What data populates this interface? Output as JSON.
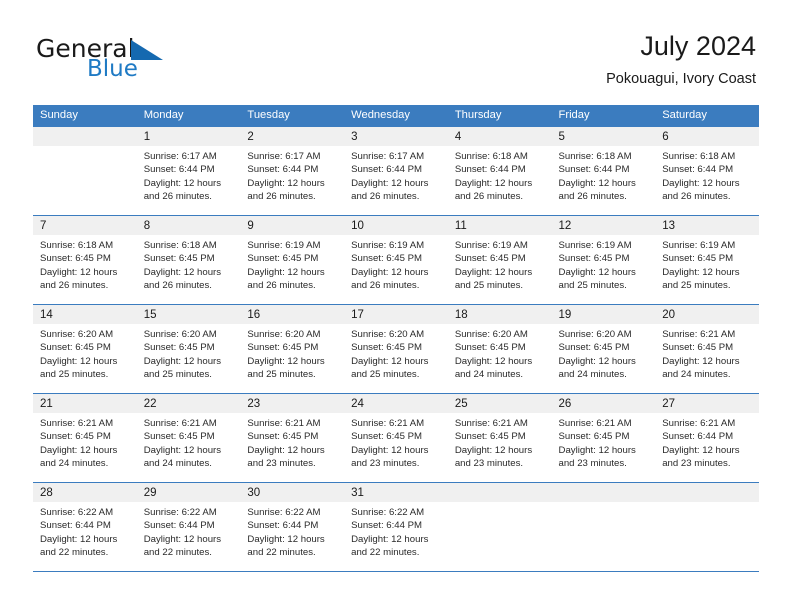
{
  "brand": {
    "name_part1": "General",
    "name_part2": "Blue",
    "logo_icon": "triangle-flag-icon",
    "accent_color": "#1569b0"
  },
  "header": {
    "title": "July 2024",
    "subtitle": "Pokouagui, Ivory Coast",
    "header_bg_color": "#3b7cbf",
    "daynum_bg_color": "#f0f0f0"
  },
  "weekdays": [
    "Sunday",
    "Monday",
    "Tuesday",
    "Wednesday",
    "Thursday",
    "Friday",
    "Saturday"
  ],
  "labels": {
    "sunrise_prefix": "Sunrise:",
    "sunset_prefix": "Sunset:",
    "daylight_prefix": "Daylight:"
  },
  "weeks": [
    [
      {
        "day": "",
        "empty": true,
        "sunrise": "",
        "sunset": "",
        "daylight_line1": "",
        "daylight_line2": ""
      },
      {
        "day": "1",
        "sunrise": "Sunrise: 6:17 AM",
        "sunset": "Sunset: 6:44 PM",
        "daylight_line1": "Daylight: 12 hours",
        "daylight_line2": "and 26 minutes."
      },
      {
        "day": "2",
        "sunrise": "Sunrise: 6:17 AM",
        "sunset": "Sunset: 6:44 PM",
        "daylight_line1": "Daylight: 12 hours",
        "daylight_line2": "and 26 minutes."
      },
      {
        "day": "3",
        "sunrise": "Sunrise: 6:17 AM",
        "sunset": "Sunset: 6:44 PM",
        "daylight_line1": "Daylight: 12 hours",
        "daylight_line2": "and 26 minutes."
      },
      {
        "day": "4",
        "sunrise": "Sunrise: 6:18 AM",
        "sunset": "Sunset: 6:44 PM",
        "daylight_line1": "Daylight: 12 hours",
        "daylight_line2": "and 26 minutes."
      },
      {
        "day": "5",
        "sunrise": "Sunrise: 6:18 AM",
        "sunset": "Sunset: 6:44 PM",
        "daylight_line1": "Daylight: 12 hours",
        "daylight_line2": "and 26 minutes."
      },
      {
        "day": "6",
        "sunrise": "Sunrise: 6:18 AM",
        "sunset": "Sunset: 6:44 PM",
        "daylight_line1": "Daylight: 12 hours",
        "daylight_line2": "and 26 minutes."
      }
    ],
    [
      {
        "day": "7",
        "sunrise": "Sunrise: 6:18 AM",
        "sunset": "Sunset: 6:45 PM",
        "daylight_line1": "Daylight: 12 hours",
        "daylight_line2": "and 26 minutes."
      },
      {
        "day": "8",
        "sunrise": "Sunrise: 6:18 AM",
        "sunset": "Sunset: 6:45 PM",
        "daylight_line1": "Daylight: 12 hours",
        "daylight_line2": "and 26 minutes."
      },
      {
        "day": "9",
        "sunrise": "Sunrise: 6:19 AM",
        "sunset": "Sunset: 6:45 PM",
        "daylight_line1": "Daylight: 12 hours",
        "daylight_line2": "and 26 minutes."
      },
      {
        "day": "10",
        "sunrise": "Sunrise: 6:19 AM",
        "sunset": "Sunset: 6:45 PM",
        "daylight_line1": "Daylight: 12 hours",
        "daylight_line2": "and 26 minutes."
      },
      {
        "day": "11",
        "sunrise": "Sunrise: 6:19 AM",
        "sunset": "Sunset: 6:45 PM",
        "daylight_line1": "Daylight: 12 hours",
        "daylight_line2": "and 25 minutes."
      },
      {
        "day": "12",
        "sunrise": "Sunrise: 6:19 AM",
        "sunset": "Sunset: 6:45 PM",
        "daylight_line1": "Daylight: 12 hours",
        "daylight_line2": "and 25 minutes."
      },
      {
        "day": "13",
        "sunrise": "Sunrise: 6:19 AM",
        "sunset": "Sunset: 6:45 PM",
        "daylight_line1": "Daylight: 12 hours",
        "daylight_line2": "and 25 minutes."
      }
    ],
    [
      {
        "day": "14",
        "sunrise": "Sunrise: 6:20 AM",
        "sunset": "Sunset: 6:45 PM",
        "daylight_line1": "Daylight: 12 hours",
        "daylight_line2": "and 25 minutes."
      },
      {
        "day": "15",
        "sunrise": "Sunrise: 6:20 AM",
        "sunset": "Sunset: 6:45 PM",
        "daylight_line1": "Daylight: 12 hours",
        "daylight_line2": "and 25 minutes."
      },
      {
        "day": "16",
        "sunrise": "Sunrise: 6:20 AM",
        "sunset": "Sunset: 6:45 PM",
        "daylight_line1": "Daylight: 12 hours",
        "daylight_line2": "and 25 minutes."
      },
      {
        "day": "17",
        "sunrise": "Sunrise: 6:20 AM",
        "sunset": "Sunset: 6:45 PM",
        "daylight_line1": "Daylight: 12 hours",
        "daylight_line2": "and 25 minutes."
      },
      {
        "day": "18",
        "sunrise": "Sunrise: 6:20 AM",
        "sunset": "Sunset: 6:45 PM",
        "daylight_line1": "Daylight: 12 hours",
        "daylight_line2": "and 24 minutes."
      },
      {
        "day": "19",
        "sunrise": "Sunrise: 6:20 AM",
        "sunset": "Sunset: 6:45 PM",
        "daylight_line1": "Daylight: 12 hours",
        "daylight_line2": "and 24 minutes."
      },
      {
        "day": "20",
        "sunrise": "Sunrise: 6:21 AM",
        "sunset": "Sunset: 6:45 PM",
        "daylight_line1": "Daylight: 12 hours",
        "daylight_line2": "and 24 minutes."
      }
    ],
    [
      {
        "day": "21",
        "sunrise": "Sunrise: 6:21 AM",
        "sunset": "Sunset: 6:45 PM",
        "daylight_line1": "Daylight: 12 hours",
        "daylight_line2": "and 24 minutes."
      },
      {
        "day": "22",
        "sunrise": "Sunrise: 6:21 AM",
        "sunset": "Sunset: 6:45 PM",
        "daylight_line1": "Daylight: 12 hours",
        "daylight_line2": "and 24 minutes."
      },
      {
        "day": "23",
        "sunrise": "Sunrise: 6:21 AM",
        "sunset": "Sunset: 6:45 PM",
        "daylight_line1": "Daylight: 12 hours",
        "daylight_line2": "and 23 minutes."
      },
      {
        "day": "24",
        "sunrise": "Sunrise: 6:21 AM",
        "sunset": "Sunset: 6:45 PM",
        "daylight_line1": "Daylight: 12 hours",
        "daylight_line2": "and 23 minutes."
      },
      {
        "day": "25",
        "sunrise": "Sunrise: 6:21 AM",
        "sunset": "Sunset: 6:45 PM",
        "daylight_line1": "Daylight: 12 hours",
        "daylight_line2": "and 23 minutes."
      },
      {
        "day": "26",
        "sunrise": "Sunrise: 6:21 AM",
        "sunset": "Sunset: 6:45 PM",
        "daylight_line1": "Daylight: 12 hours",
        "daylight_line2": "and 23 minutes."
      },
      {
        "day": "27",
        "sunrise": "Sunrise: 6:21 AM",
        "sunset": "Sunset: 6:44 PM",
        "daylight_line1": "Daylight: 12 hours",
        "daylight_line2": "and 23 minutes."
      }
    ],
    [
      {
        "day": "28",
        "sunrise": "Sunrise: 6:22 AM",
        "sunset": "Sunset: 6:44 PM",
        "daylight_line1": "Daylight: 12 hours",
        "daylight_line2": "and 22 minutes."
      },
      {
        "day": "29",
        "sunrise": "Sunrise: 6:22 AM",
        "sunset": "Sunset: 6:44 PM",
        "daylight_line1": "Daylight: 12 hours",
        "daylight_line2": "and 22 minutes."
      },
      {
        "day": "30",
        "sunrise": "Sunrise: 6:22 AM",
        "sunset": "Sunset: 6:44 PM",
        "daylight_line1": "Daylight: 12 hours",
        "daylight_line2": "and 22 minutes."
      },
      {
        "day": "31",
        "sunrise": "Sunrise: 6:22 AM",
        "sunset": "Sunset: 6:44 PM",
        "daylight_line1": "Daylight: 12 hours",
        "daylight_line2": "and 22 minutes."
      },
      {
        "day": "",
        "empty": true,
        "sunrise": "",
        "sunset": "",
        "daylight_line1": "",
        "daylight_line2": ""
      },
      {
        "day": "",
        "empty": true,
        "sunrise": "",
        "sunset": "",
        "daylight_line1": "",
        "daylight_line2": ""
      },
      {
        "day": "",
        "empty": true,
        "sunrise": "",
        "sunset": "",
        "daylight_line1": "",
        "daylight_line2": ""
      }
    ]
  ]
}
